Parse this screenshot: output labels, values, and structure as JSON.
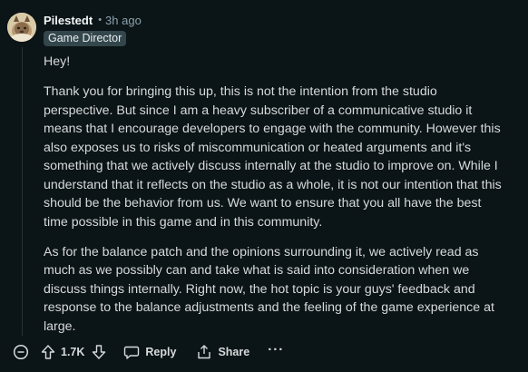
{
  "comment": {
    "author": "Pilestedt",
    "separator": "•",
    "time_ago": "3h ago",
    "flair": "Game Director",
    "paragraphs": [
      "Hey!",
      "Thank you for bringing this up, this is not the intention from the studio perspective. But since I am a heavy subscriber of a communicative studio it means that I encourage developers to engage with the community. However this also exposes us to risks of miscommunication or heated arguments and it's something that we actively discuss internally at the studio to improve on. While I understand that it reflects on the studio as a whole, it is not our intention that this should be the behavior from us. We want to ensure that you all have the best time possible in this game and in this community.",
      "As for the balance patch and the opinions surrounding it, we actively read as much as we possibly can and take what is said into consideration when we discuss things internally. Right now, the hot topic is your guys' feedback and response to the balance adjustments and the feeling of the game experience at large."
    ]
  },
  "actions": {
    "vote_count": "1.7K",
    "reply_label": "Reply",
    "share_label": "Share",
    "more_label": "···"
  },
  "icons": {
    "collapse": "collapse-circle-minus-icon",
    "upvote": "upvote-arrow-icon",
    "downvote": "downvote-arrow-icon",
    "reply": "speech-bubble-icon",
    "share": "share-arrow-icon",
    "more": "more-dots-icon"
  },
  "colors": {
    "background": "#0b1416",
    "text": "#d7dadc",
    "muted": "#8ba2ad",
    "flair_bg": "#33464c",
    "thread_line": "#2a3236"
  }
}
